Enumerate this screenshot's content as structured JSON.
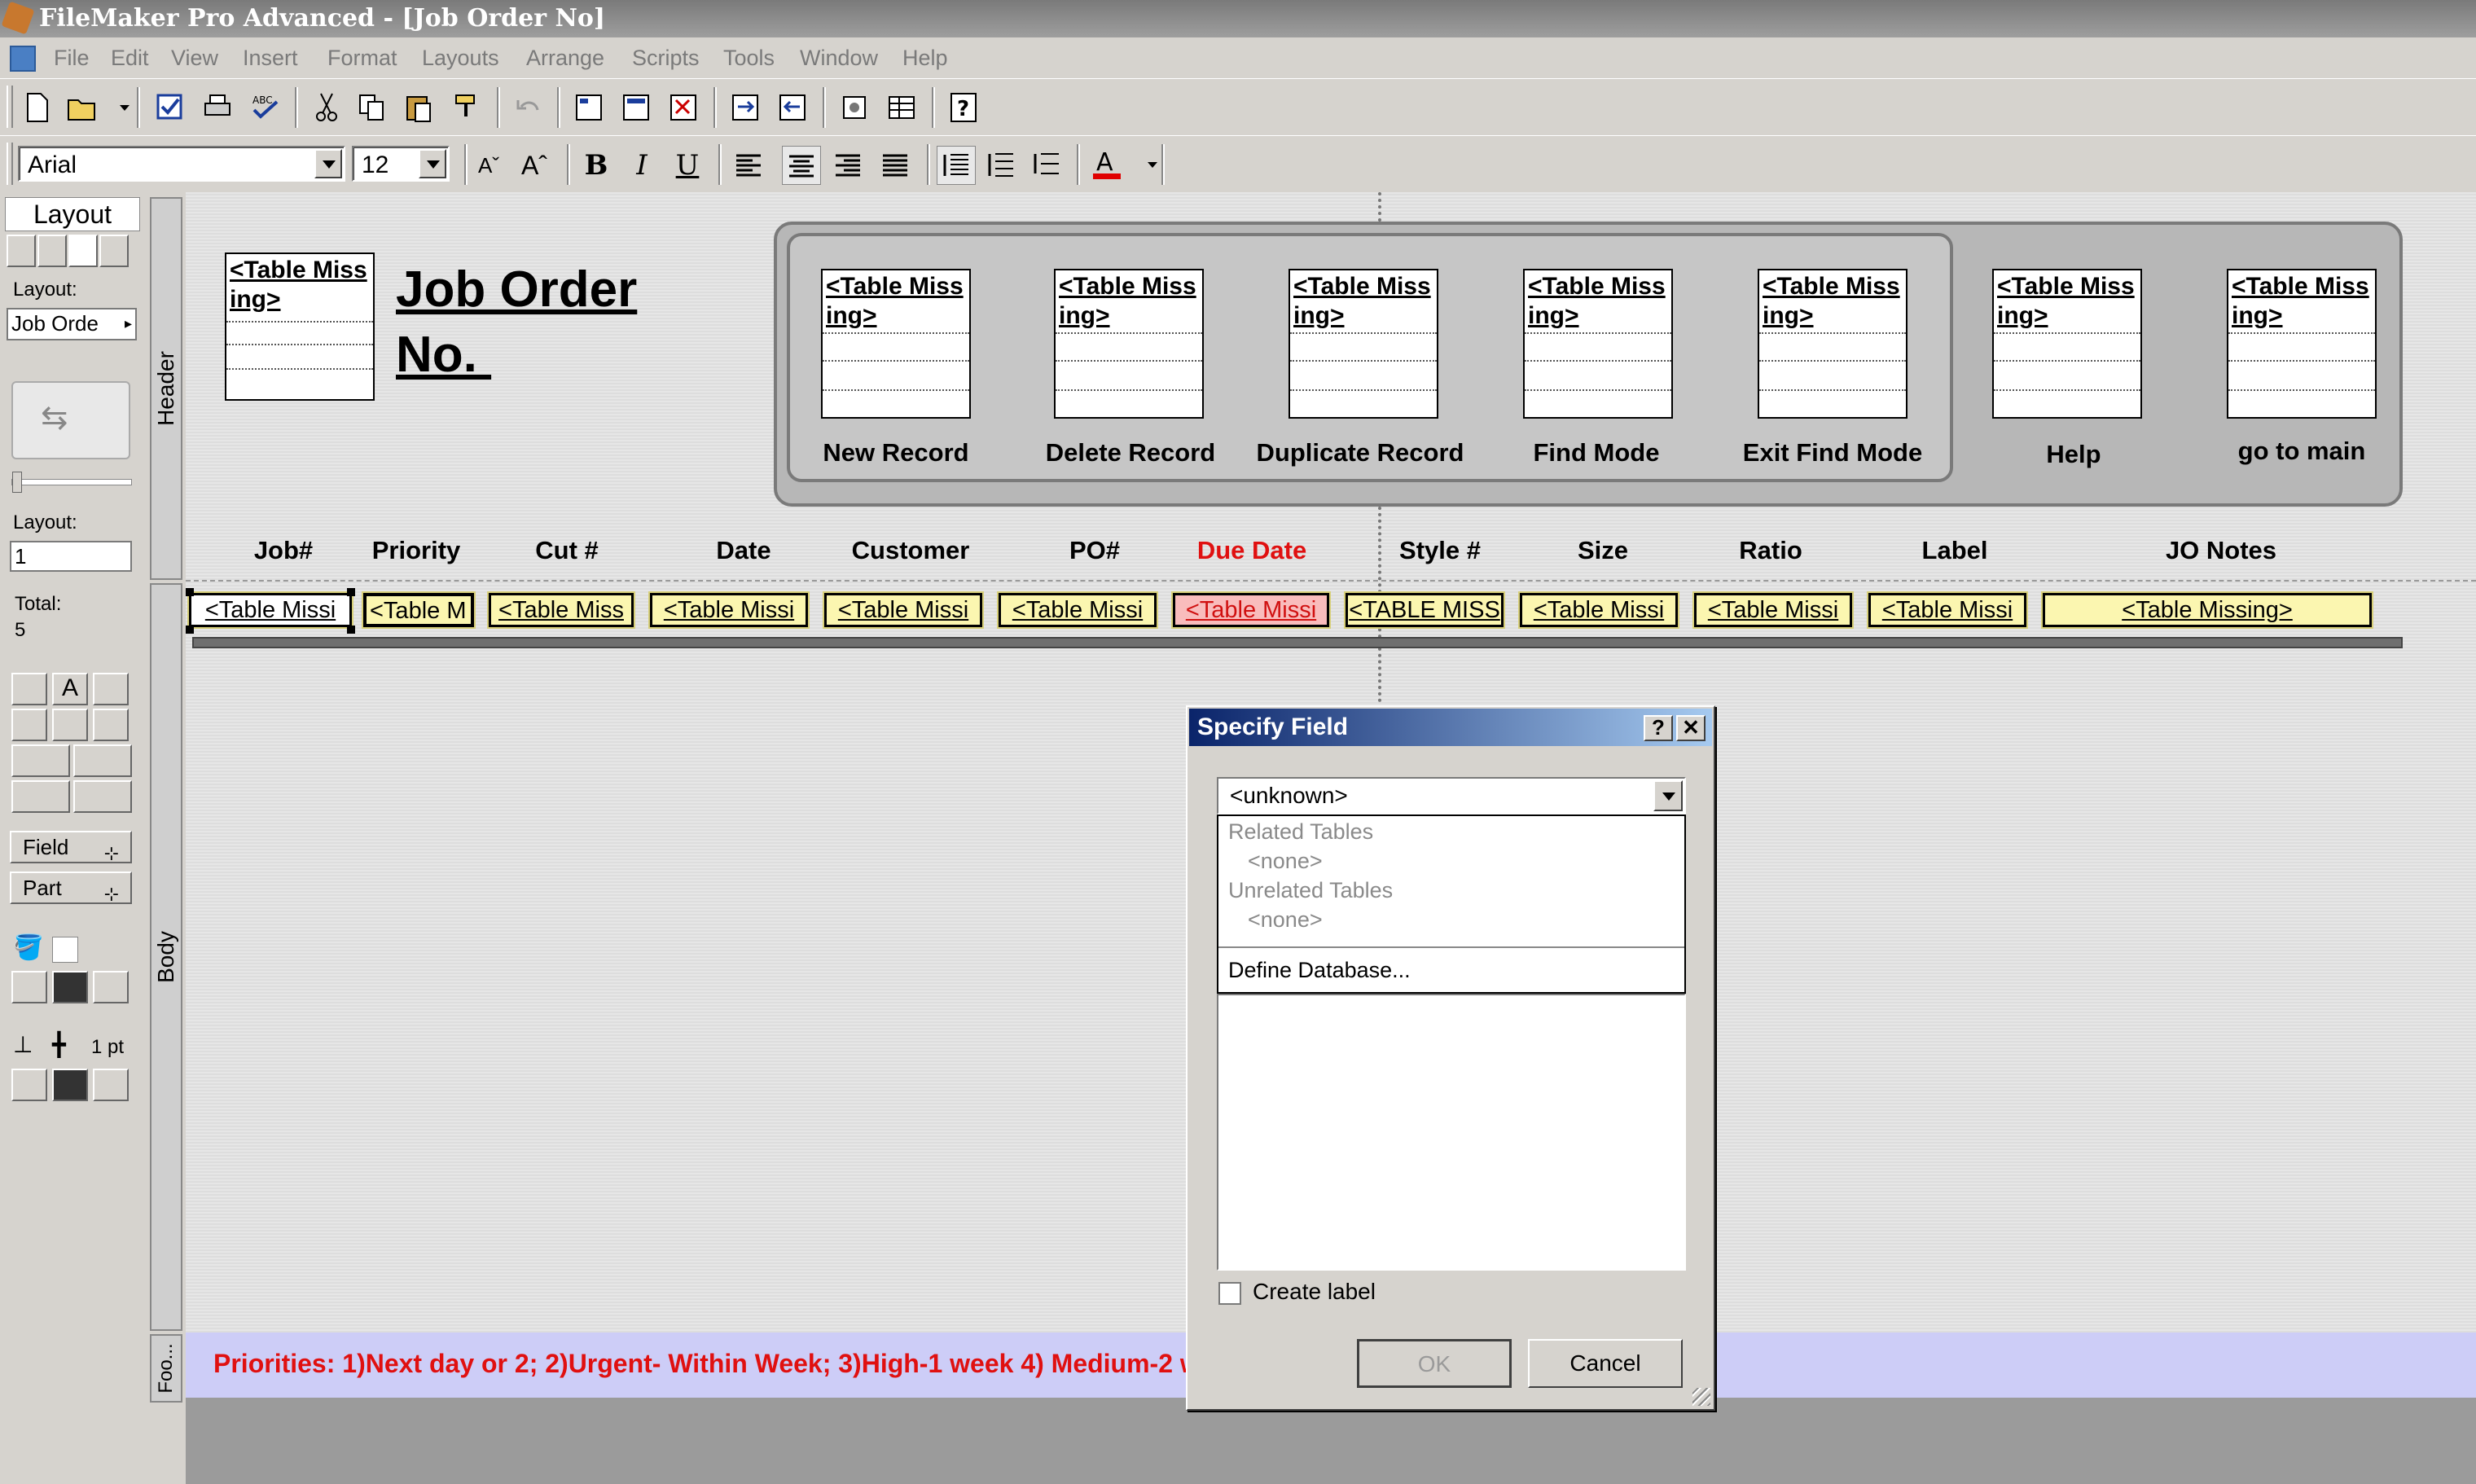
{
  "window": {
    "title": "FileMaker Pro Advanced - [Job Order No]"
  },
  "menu": [
    "File",
    "Edit",
    "View",
    "Insert",
    "Format",
    "Layouts",
    "Arrange",
    "Scripts",
    "Tools",
    "Window",
    "Help"
  ],
  "text_format": {
    "font": "Arial",
    "size": "12"
  },
  "status_area": {
    "mode": "Layout",
    "layout_label": "Layout:",
    "layout_name": "Job Orde",
    "layout_num_label": "Layout:",
    "layout_num": "1",
    "total_label": "Total:",
    "total": "5",
    "field_button": "Field",
    "part_button": "Part",
    "line_width": "1 pt"
  },
  "parts": {
    "header": "Header",
    "body": "Body",
    "footer": "Foo..."
  },
  "header": {
    "logo_placeholder": "<Table Miss ing>",
    "title_line1": "Job Order",
    "title_line2": "No. ",
    "buttons": [
      {
        "placeholder": "<Table Miss ing>",
        "label": "New Record"
      },
      {
        "placeholder": "<Table Miss ing>",
        "label": "Delete Record"
      },
      {
        "placeholder": "<Table Miss ing>",
        "label": "Duplicate Record"
      },
      {
        "placeholder": "<Table Miss ing>",
        "label": "Find Mode"
      },
      {
        "placeholder": "<Table Miss ing>",
        "label": "Exit Find Mode"
      },
      {
        "placeholder": "<Table Miss ing>",
        "label": "Help"
      },
      {
        "placeholder": "<Table Miss ing>",
        "label": "go to main"
      }
    ]
  },
  "columns": [
    "Job#",
    "Priority",
    "Cut #",
    "Date",
    "Customer",
    "PO#",
    "Due Date",
    "Style #",
    "Size",
    "Ratio",
    "Label",
    "JO Notes"
  ],
  "fields": [
    "<Table Missi",
    "<Table M",
    "<Table Miss",
    "<Table Missi",
    "<Table Missi",
    "<Table Missi",
    "<Table Missi",
    "<TABLE MISS",
    "<Table Missi",
    "<Table Missi",
    "<Table Missi",
    "<Table Missing>"
  ],
  "footer": {
    "text": "Priorities: 1)Next day or 2;   2)Urgent- Within Week;   3)High-1 week  4) Medium-2 we"
  },
  "dialog": {
    "title": "Specify Field",
    "help_btn": "?",
    "close_btn": "✕",
    "selected": "<unknown>",
    "options": {
      "related": "Related Tables",
      "related_none": "<none>",
      "unrelated": "Unrelated Tables",
      "unrelated_none": "<none>",
      "define": "Define Database..."
    },
    "create_label": "Create label",
    "ok": "OK",
    "cancel": "Cancel"
  },
  "colors": {
    "field_bg": "#fbf6b0",
    "due_date": "#e01010",
    "footer_bg": "#cdcdf7",
    "dialog_title": "#0a246a"
  }
}
